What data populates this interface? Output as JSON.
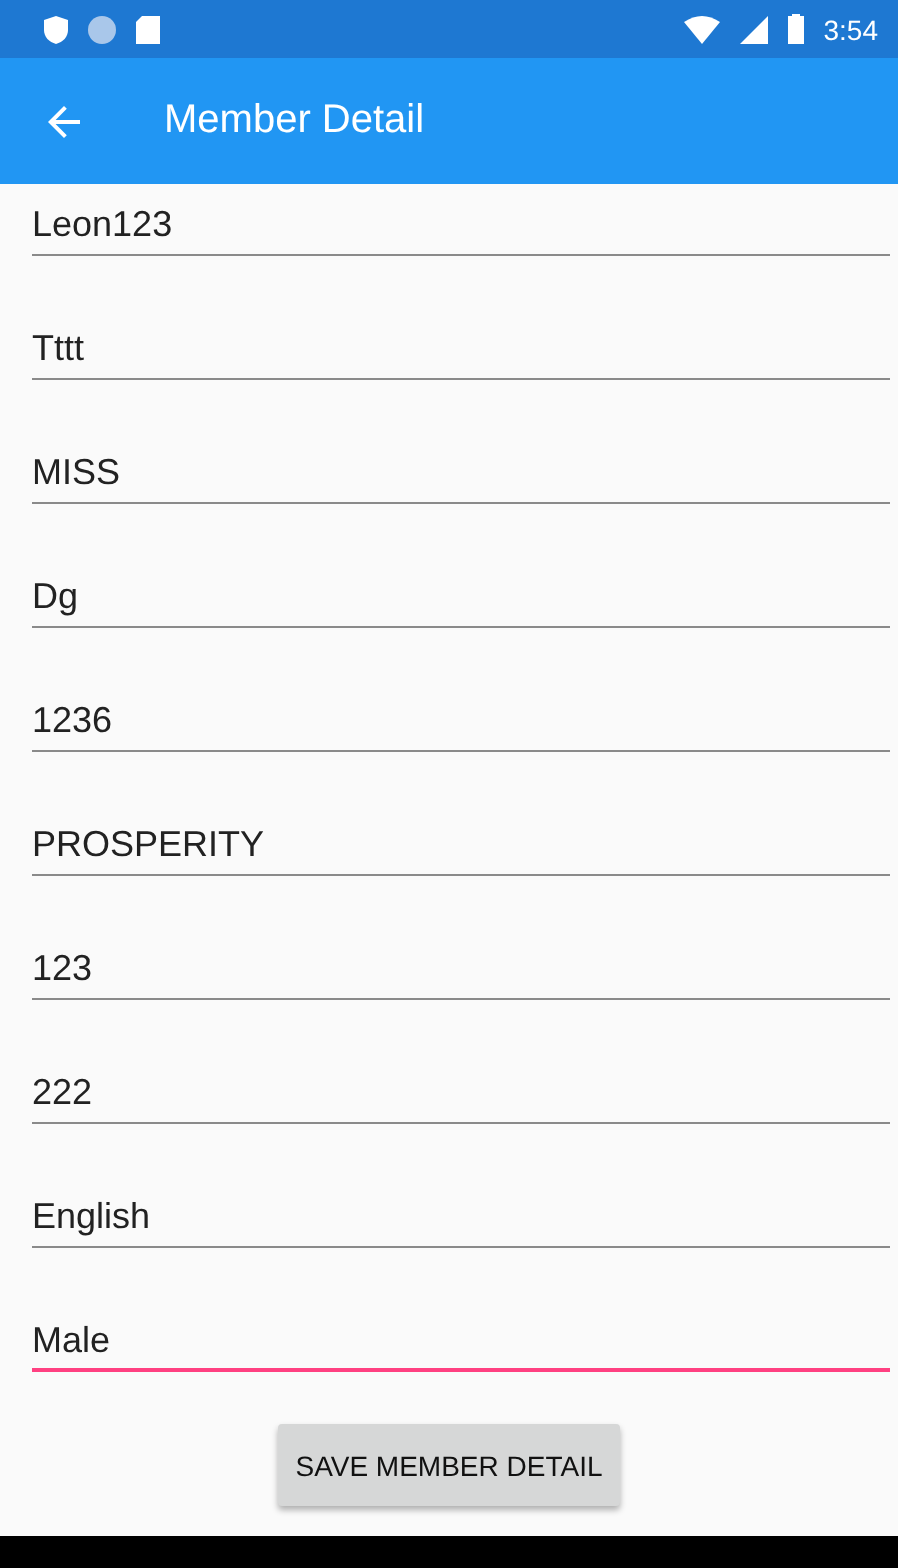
{
  "status_bar": {
    "time": "3:54"
  },
  "app_bar": {
    "title": "Member Detail"
  },
  "fields": [
    {
      "value": "Leon123",
      "focused": false
    },
    {
      "value": "Tttt",
      "focused": false
    },
    {
      "value": "MISS",
      "focused": false
    },
    {
      "value": "Dg",
      "focused": false
    },
    {
      "value": "1236",
      "focused": false
    },
    {
      "value": "PROSPERITY",
      "focused": false
    },
    {
      "value": "123",
      "focused": false
    },
    {
      "value": "222",
      "focused": false
    },
    {
      "value": "English",
      "focused": false
    },
    {
      "value": "Male",
      "focused": true
    }
  ],
  "buttons": [
    "SAVE MEMBER DETAIL"
  ]
}
